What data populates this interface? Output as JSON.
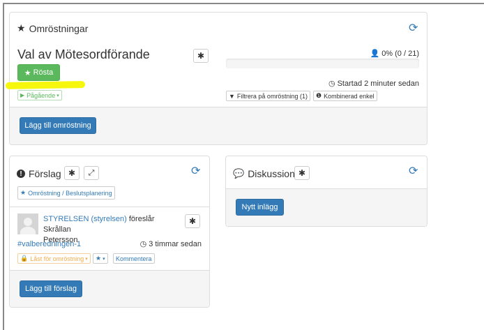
{
  "polls_panel": {
    "title": "Omröstningar",
    "poll_title": "Val av Mötesordförande",
    "vote_button": "Rösta",
    "status_label": "Pågående",
    "voters": "0% (0 / 21)",
    "progress_percent": 0,
    "started": "Startad 2 minuter sedan",
    "filter_button": "Filtrera på omröstning (1)",
    "method_button": "Kombinerad enkel",
    "add_poll_button": "Lägg till omröstning"
  },
  "proposals_panel": {
    "title": "Förslag",
    "tag_button": "Omröstning / Beslutsplanering",
    "author": "STYRELSEN (styrelsen)",
    "proposes": "föreslår Skrållan",
    "proposes_cont": "Petersson",
    "hashtag": "#valberedningen-1",
    "time": "3 timmar sedan",
    "locked_button": "Låst för omröstning",
    "comment_button": "Kommentera",
    "add_proposal_button": "Lägg till förslag"
  },
  "discussion_panel": {
    "title": "Diskussion",
    "new_post_button": "Nytt inlägg"
  },
  "colors": {
    "primary": "#337ab7",
    "success": "#5cb85c",
    "warning": "#f0ad4e",
    "highlight": "#f7f700"
  }
}
